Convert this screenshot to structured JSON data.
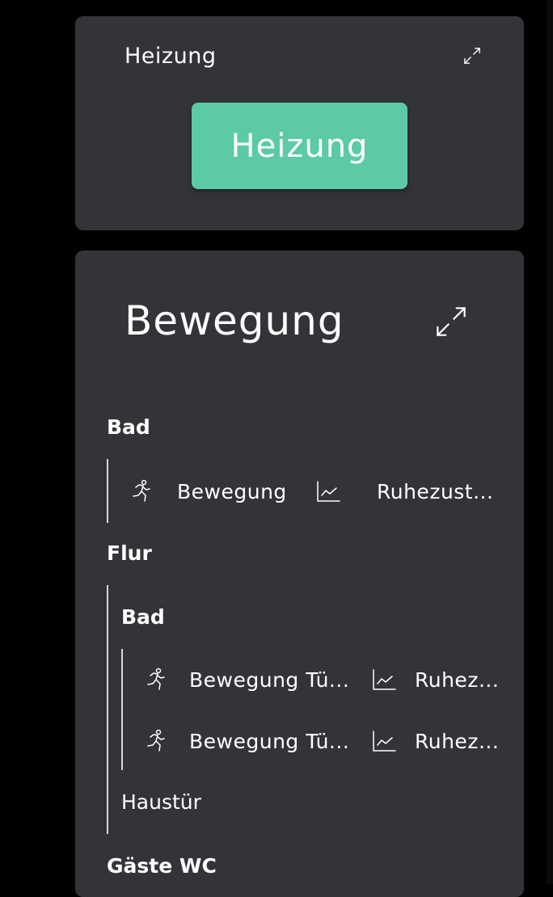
{
  "heizung_card": {
    "title": "Heizung",
    "button_label": "Heizung",
    "button_color": "#5ccaa7"
  },
  "bewegung_card": {
    "title": "Bewegung",
    "groups": {
      "bad": {
        "label": "Bad",
        "items": [
          {
            "icon": "running-person-icon",
            "label": "Bewegung",
            "chart_icon": "line-chart-icon",
            "state": "Ruhezust..."
          }
        ]
      },
      "flur": {
        "label": "Flur",
        "subgroup_bad": {
          "label": "Bad",
          "items": [
            {
              "icon": "running-person-icon",
              "label": "Bewegung Tü...",
              "chart_icon": "line-chart-icon",
              "state": "Ruhez..."
            },
            {
              "icon": "running-person-icon",
              "label": "Bewegung Tü...",
              "chart_icon": "line-chart-icon",
              "state": "Ruhez..."
            }
          ]
        },
        "haustuer_label": "Haustür"
      },
      "gaeste_wc": {
        "label": "Gäste WC"
      }
    }
  },
  "colors": {
    "background": "#000000",
    "card": "#333438",
    "accent": "#5ccaa7",
    "text": "#ffffff"
  }
}
